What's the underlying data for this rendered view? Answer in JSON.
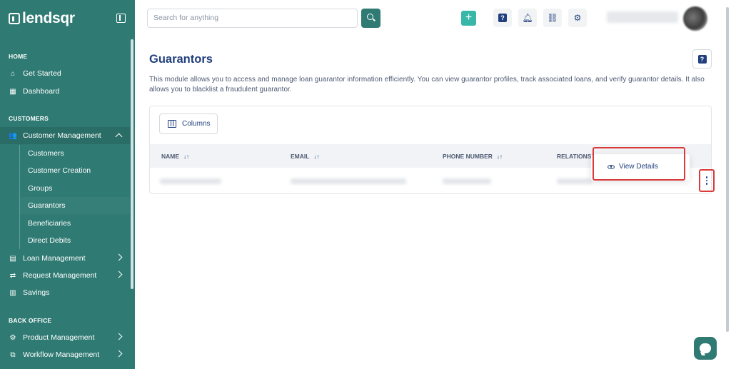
{
  "brand": {
    "name": "lendsqr"
  },
  "sidebar": {
    "sections": [
      {
        "title": "HOME",
        "items": [
          {
            "label": "Get Started",
            "icon": "home-icon"
          },
          {
            "label": "Dashboard",
            "icon": "dashboard-icon"
          }
        ]
      },
      {
        "title": "CUSTOMERS",
        "items": [
          {
            "label": "Customer Management",
            "icon": "users-icon",
            "expanded": true
          }
        ]
      },
      {
        "title": "BACK OFFICE",
        "items": [
          {
            "label": "Product Management",
            "icon": "product-icon"
          },
          {
            "label": "Workflow Management",
            "icon": "workflow-icon"
          }
        ]
      }
    ],
    "sub_items": [
      "Customers",
      "Customer Creation",
      "Groups",
      "Guarantors",
      "Beneficiaries",
      "Direct Debits"
    ],
    "active_sub_item": "Guarantors",
    "other_items": [
      {
        "label": "Loan Management",
        "icon": "loan-icon"
      },
      {
        "label": "Request Management",
        "icon": "request-icon"
      },
      {
        "label": "Savings",
        "icon": "savings-icon"
      }
    ]
  },
  "topbar": {
    "search_placeholder": "Search for anything"
  },
  "page": {
    "title": "Guarantors",
    "description": "This module allows you to access and manage loan guarantor information efficiently. You can view guarantor profiles, track associated loans, and verify guarantor details. It also allows you to blacklist a fraudulent guarantor."
  },
  "table": {
    "columns_button": "Columns",
    "headers": [
      "NAME",
      "EMAIL",
      "PHONE NUMBER",
      "RELATIONSHIP"
    ]
  },
  "row_menu": {
    "items": [
      "View Details"
    ]
  },
  "colors": {
    "sidebar_bg": "#2f7a73",
    "accent": "#38b7a8",
    "text_primary": "#213f7d",
    "highlight": "#d93a3a"
  }
}
